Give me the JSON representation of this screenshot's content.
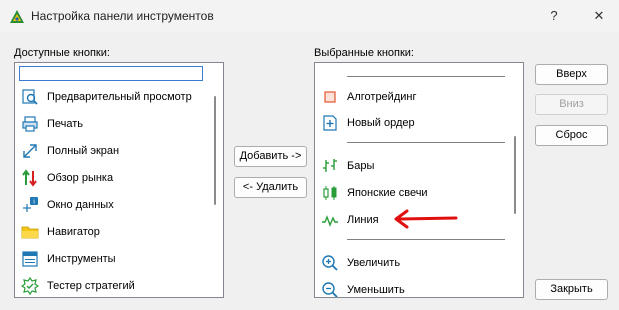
{
  "window": {
    "title": "Настройка панели инструментов",
    "help": "?",
    "close": "✕"
  },
  "available": {
    "label": "Доступные кнопки:",
    "items": [
      {
        "label": "Предварительный просмотр",
        "icon": "print-preview-icon"
      },
      {
        "label": "Печать",
        "icon": "printer-icon"
      },
      {
        "label": "Полный экран",
        "icon": "fullscreen-icon"
      },
      {
        "label": "Обзор рынка",
        "icon": "market-watch-icon"
      },
      {
        "label": "Окно данных",
        "icon": "data-window-icon"
      },
      {
        "label": "Навигатор",
        "icon": "navigator-folder-icon"
      },
      {
        "label": "Инструменты",
        "icon": "toolbox-icon"
      },
      {
        "label": "Тестер стратегий",
        "icon": "strategy-tester-icon"
      }
    ]
  },
  "middle": {
    "add": "Добавить ->",
    "remove": "<- Удалить"
  },
  "selected": {
    "label": "Выбранные кнопки:",
    "items": [
      {
        "label": "Алготрейдинг",
        "icon": "algo-trading-icon"
      },
      {
        "label": "Новый ордер",
        "icon": "new-order-icon"
      },
      {
        "label": "Бары",
        "icon": "bar-chart-icon"
      },
      {
        "label": "Японские свечи",
        "icon": "candlesticks-icon"
      },
      {
        "label": "Линия",
        "icon": "line-chart-icon"
      },
      {
        "label": "Увеличить",
        "icon": "zoom-in-icon"
      },
      {
        "label": "Уменьшить",
        "icon": "zoom-out-icon"
      }
    ]
  },
  "right": {
    "up": "Вверх",
    "down": "Вниз",
    "reset": "Сброс",
    "close": "Закрыть"
  },
  "colors": {
    "annotation_arrow": "#e01010",
    "accent": "#3b7bd0"
  }
}
